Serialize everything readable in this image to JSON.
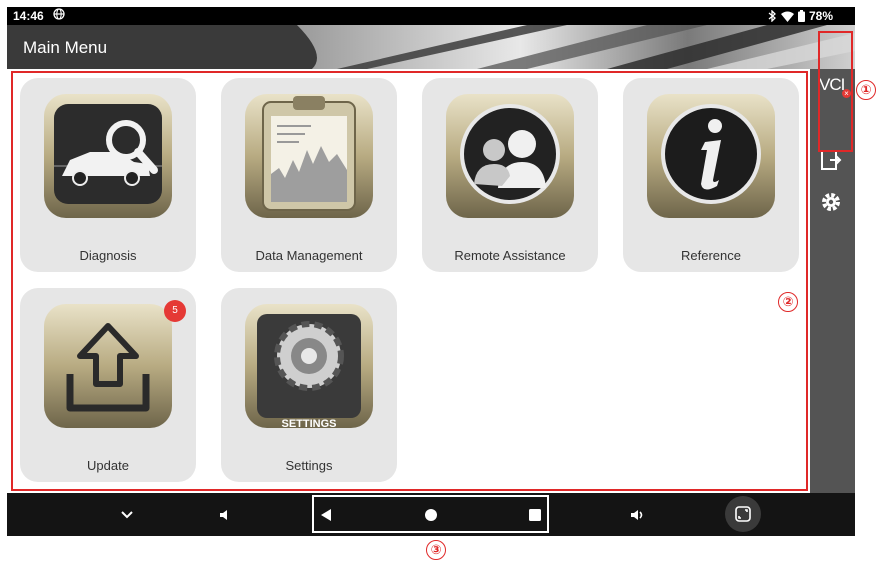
{
  "status_bar": {
    "time": "14:46",
    "battery": "78%"
  },
  "header": {
    "title": "Main Menu"
  },
  "side_panel": {
    "vci_label": "VCI",
    "items": [
      {
        "icon": "exit-icon"
      },
      {
        "icon": "gear-icon"
      }
    ]
  },
  "tiles": [
    {
      "label": "Diagnosis",
      "icon": "car-search-icon"
    },
    {
      "label": "Data Management",
      "icon": "clipboard-chart-icon"
    },
    {
      "label": "Remote Assistance",
      "icon": "users-icon"
    },
    {
      "label": "Reference",
      "icon": "info-icon"
    },
    {
      "label": "Update",
      "icon": "upload-icon",
      "badge": "5"
    },
    {
      "label": "Settings",
      "icon": "settings-gear-icon",
      "caption": "SETTINGS"
    }
  ],
  "nav_bar": {
    "buttons": [
      "chevron-down-icon",
      "volume-down-icon",
      "back-icon",
      "home-icon",
      "recents-icon",
      "volume-up-icon",
      "screenshot-icon"
    ]
  },
  "annotations": {
    "marker_1": "①",
    "marker_2": "②",
    "marker_3": "③"
  },
  "colors": {
    "accent_red": "#e02828",
    "tile_bg": "#e6e6e6",
    "header_bg": "#4a4a4a",
    "side_bg": "#545454"
  }
}
